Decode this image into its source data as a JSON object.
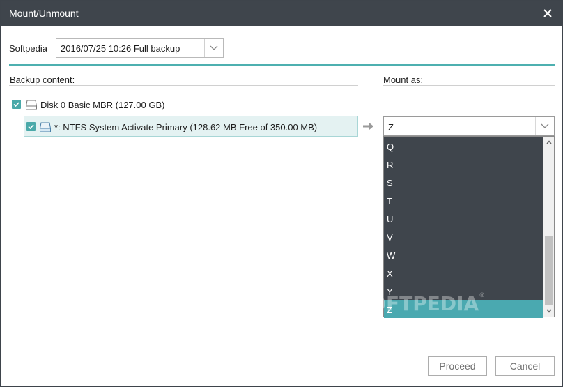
{
  "window": {
    "title": "Mount/Unmount"
  },
  "backup": {
    "label": "Softpedia",
    "selected": "2016/07/25 10:26 Full backup"
  },
  "sections": {
    "backup_content": "Backup content:",
    "mount_as": "Mount as:"
  },
  "tree": {
    "disk": {
      "label": "Disk 0 Basic MBR (127.00 GB)",
      "checked": true
    },
    "partition": {
      "label": "*: NTFS System Activate Primary  (128.62 MB Free of 350.00 MB)",
      "checked": true
    }
  },
  "mount": {
    "selected": "Z",
    "options": [
      "Q",
      "R",
      "S",
      "T",
      "U",
      "V",
      "W",
      "X",
      "Y",
      "Z"
    ]
  },
  "watermark": {
    "text": "SOFTPEDIA",
    "mark": "®"
  },
  "buttons": {
    "proceed": "Proceed",
    "cancel": "Cancel"
  },
  "colors": {
    "titlebar": "#3f454c",
    "accent": "#4aa9b0",
    "dropdown_bg": "#3f454c"
  }
}
